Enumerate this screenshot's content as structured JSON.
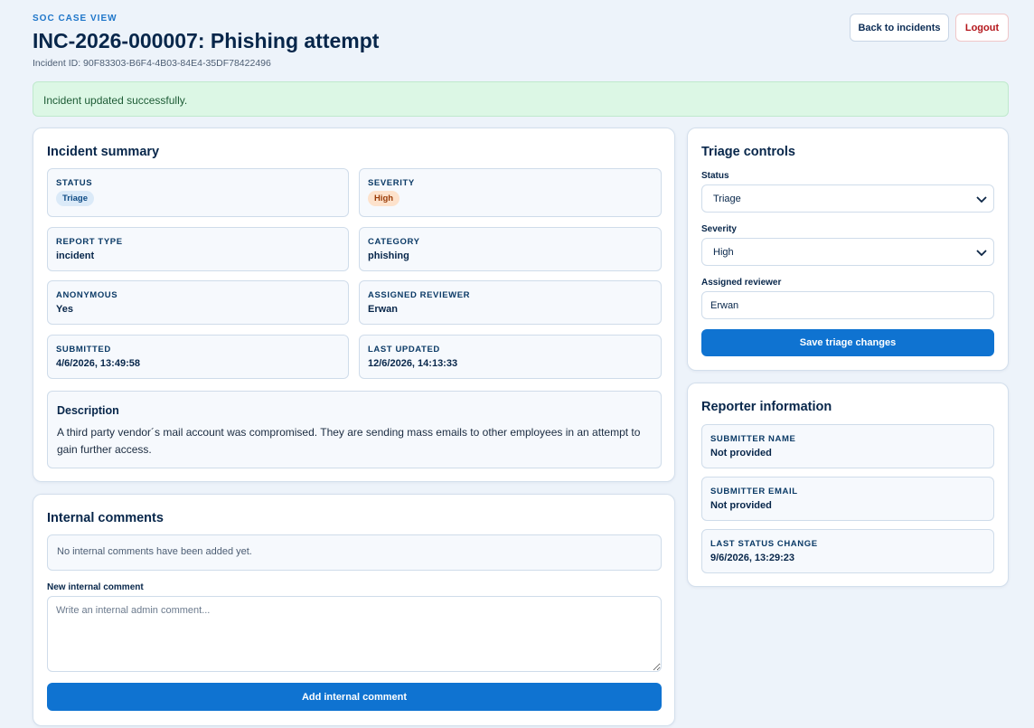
{
  "header": {
    "eyebrow": "SOC CASE VIEW",
    "title": "INC-2026-000007: Phishing attempt",
    "incident_id": "Incident ID: 90F83303-B6F4-4B03-84E4-35DF78422496",
    "back_label": "Back to incidents",
    "logout_label": "Logout"
  },
  "alert": {
    "message": "Incident updated successfully."
  },
  "summary": {
    "title": "Incident summary",
    "status": {
      "label": "STATUS",
      "value": "Triage"
    },
    "severity": {
      "label": "SEVERITY",
      "value": "High"
    },
    "report_type": {
      "label": "REPORT TYPE",
      "value": "incident"
    },
    "category": {
      "label": "CATEGORY",
      "value": "phishing"
    },
    "anonymous": {
      "label": "ANONYMOUS",
      "value": "Yes"
    },
    "assigned_reviewer": {
      "label": "ASSIGNED REVIEWER",
      "value": "Erwan"
    },
    "submitted": {
      "label": "SUBMITTED",
      "value": "4/6/2026, 13:49:58"
    },
    "last_updated": {
      "label": "LAST UPDATED",
      "value": "12/6/2026, 14:13:33"
    },
    "description": {
      "title": "Description",
      "text": "A third party vendor´s mail account was compromised. They are sending mass emails to other employees in an attempt to gain further access."
    }
  },
  "comments": {
    "title": "Internal comments",
    "empty_message": "No internal comments have been added yet.",
    "new_label": "New internal comment",
    "placeholder": "Write an internal admin comment...",
    "value": "",
    "add_label": "Add internal comment"
  },
  "triage": {
    "title": "Triage controls",
    "status_label": "Status",
    "status_value": "Triage",
    "severity_label": "Severity",
    "severity_value": "High",
    "reviewer_label": "Assigned reviewer",
    "reviewer_value": "Erwan",
    "save_label": "Save triage changes"
  },
  "reporter": {
    "title": "Reporter information",
    "name": {
      "label": "SUBMITTER NAME",
      "value": "Not provided"
    },
    "email": {
      "label": "SUBMITTER EMAIL",
      "value": "Not provided"
    },
    "status_change": {
      "label": "LAST STATUS CHANGE",
      "value": "9/6/2026, 13:29:23"
    }
  },
  "colors": {
    "accent": "#0f73d1",
    "background": "#edf3fa",
    "success_bg": "#dcf7e5",
    "logout": "#b4161b",
    "badge_triage": "#dbeaf8",
    "badge_high": "#fde2cc"
  }
}
